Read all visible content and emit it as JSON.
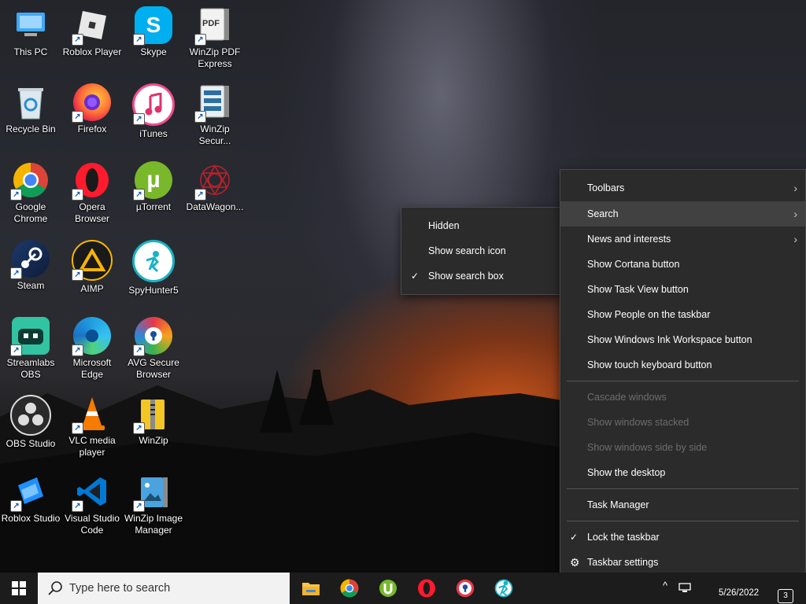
{
  "desktop": {
    "icons": [
      {
        "label": "This PC"
      },
      {
        "label": "Roblox Player"
      },
      {
        "label": "Skype"
      },
      {
        "label": "WinZip PDF Express"
      },
      {
        "label": "Recycle Bin"
      },
      {
        "label": "Firefox"
      },
      {
        "label": "iTunes"
      },
      {
        "label": "WinZip Secur..."
      },
      {
        "label": "Google Chrome"
      },
      {
        "label": "Opera Browser"
      },
      {
        "label": "µTorrent"
      },
      {
        "label": "DataWagon..."
      },
      {
        "label": "Steam"
      },
      {
        "label": "AIMP"
      },
      {
        "label": "SpyHunter5"
      },
      {
        "label": "Streamlabs OBS"
      },
      {
        "label": "Microsoft Edge"
      },
      {
        "label": "AVG Secure Browser"
      },
      {
        "label": "OBS Studio"
      },
      {
        "label": "VLC media player"
      },
      {
        "label": "WinZip"
      },
      {
        "label": "Roblox Studio"
      },
      {
        "label": "Visual Studio Code"
      },
      {
        "label": "WinZip Image Manager"
      }
    ],
    "glyphs": {
      "pdf": "PDF",
      "utorrent": "µ",
      "skype": "S"
    }
  },
  "search_submenu": {
    "items": [
      "Hidden",
      "Show search icon",
      "Show search box"
    ],
    "checked": "Show search box",
    "check_glyph": "✓"
  },
  "taskbar_menu": {
    "toolbars": "Toolbars",
    "search": "Search",
    "news": "News and interests",
    "cortana": "Show Cortana button",
    "task_view": "Show Task View button",
    "people": "Show People on the taskbar",
    "ink": "Show Windows Ink Workspace button",
    "touch_keyboard": "Show touch keyboard button",
    "cascade": "Cascade windows",
    "stacked": "Show windows stacked",
    "side_by_side": "Show windows side by side",
    "show_desktop": "Show the desktop",
    "task_manager": "Task Manager",
    "lock": "Lock the taskbar",
    "settings": "Taskbar settings",
    "chevron": "›",
    "check_glyph": "✓",
    "gear_glyph": "⚙"
  },
  "taskbar": {
    "search_placeholder": "Type here to search",
    "date": "5/26/2022",
    "notification_count": "3",
    "tray_caret": "^"
  },
  "colors": {
    "menu_bg": "#2b2b2b",
    "menu_highlight": "#414141",
    "taskbar_bg": "#1c1c1c"
  }
}
